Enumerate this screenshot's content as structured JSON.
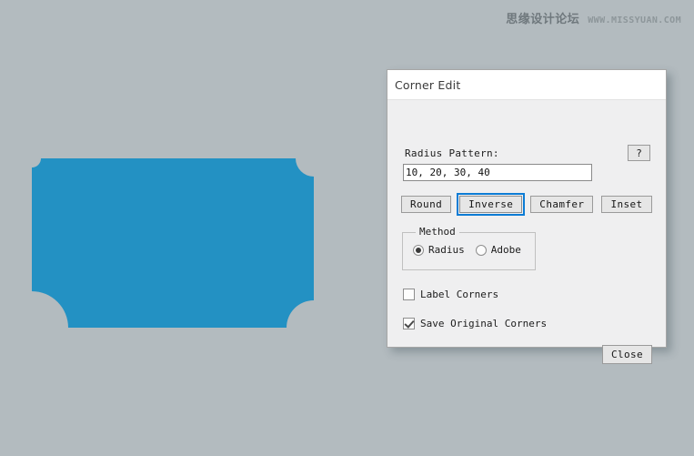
{
  "canvas": {
    "background_color": "#b3bbbf",
    "shape": {
      "fill_color": "#2391c3",
      "corner_style": "inverse",
      "radius_pattern": [
        10,
        20,
        30,
        40
      ],
      "corner_order": [
        "top-left",
        "top-right",
        "bottom-right",
        "bottom-left"
      ]
    }
  },
  "watermark": {
    "forum_name": "思缘设计论坛",
    "url": "WWW.MISSYUAN.COM"
  },
  "dialog": {
    "title": "Corner Edit",
    "radius": {
      "label": "Radius Pattern:",
      "help_label": "?",
      "input_value": "10, 20, 30, 40",
      "input_placeholder": "10, 20, 30, 40"
    },
    "actions": [
      {
        "label": "Round",
        "focused": false
      },
      {
        "label": "Inverse",
        "focused": true
      },
      {
        "label": "Chamfer",
        "focused": false
      },
      {
        "label": "Inset",
        "focused": false
      }
    ],
    "method": {
      "legend": "Method",
      "options": [
        {
          "label": "Radius",
          "selected": true
        },
        {
          "label": "Adobe",
          "selected": false
        }
      ]
    },
    "checkboxes": [
      {
        "label": "Label Corners",
        "checked": false
      },
      {
        "label": "Save Original Corners",
        "checked": true
      }
    ],
    "close_label": "Close",
    "accent_color": "#0c7cd5",
    "surface_color": "#efeff0",
    "titlebar_color": "#ffffff"
  }
}
